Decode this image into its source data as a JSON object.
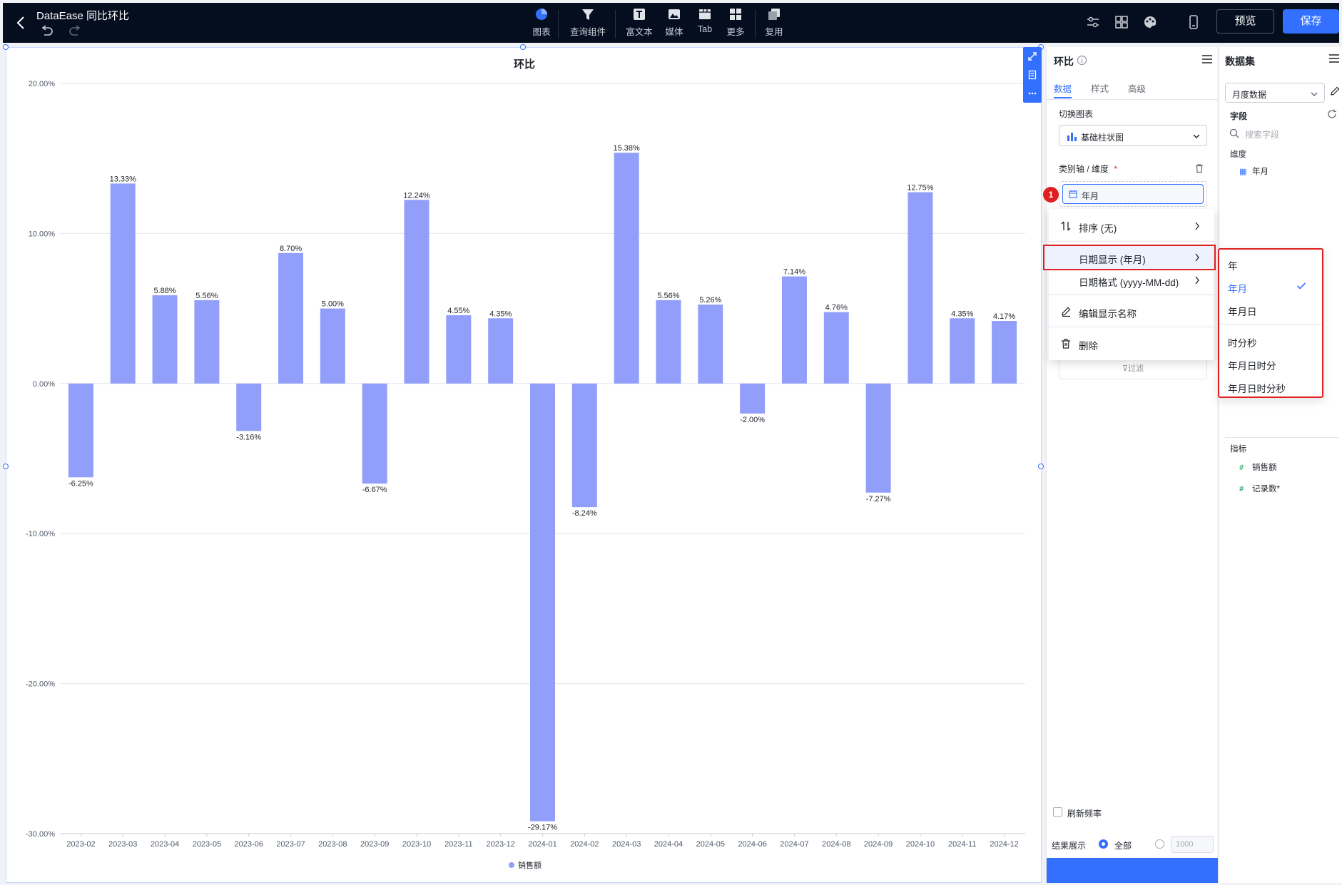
{
  "app": {
    "title": "DataEase 同比环比"
  },
  "toolbar": {
    "chart": "图表",
    "query": "查询组件",
    "richtext": "富文本",
    "media": "媒体",
    "tab": "Tab",
    "more": "更多",
    "reuse": "复用",
    "preview": "预览",
    "save": "保存"
  },
  "config": {
    "title": "环比",
    "tabs": [
      "数据",
      "样式",
      "高级"
    ],
    "switch_chart_label": "切换图表",
    "chart_type": "基础柱状图",
    "axis_label": "类别轴 / 维度",
    "required_mark": "*",
    "dimension_field": "年月",
    "badge": "1",
    "filter_text": "过滤",
    "refresh_label": "刷新频率",
    "result_label": "结果展示",
    "result_all": "全部",
    "result_limit": "1000"
  },
  "context_menu": {
    "sort": "排序 (无)",
    "date_display": "日期显示 (年月)",
    "date_format": "日期格式 (yyyy-MM-dd)",
    "edit_name": "编辑显示名称",
    "delete": "删除"
  },
  "date_submenu": {
    "items": [
      "年",
      "年月",
      "年月日",
      "时分秒",
      "年月日时分",
      "年月日时分秒"
    ],
    "selected": "年月"
  },
  "dataset": {
    "title": "数据集",
    "selected": "月度数据",
    "fields_label": "字段",
    "search_placeholder": "搜索字段",
    "dimension_label": "维度",
    "dimensions": [
      "年月"
    ],
    "metric_label": "指标",
    "metrics": [
      "销售额",
      "记录数*"
    ]
  },
  "colors": {
    "bar": "#929ffa",
    "accent": "#3370ff",
    "topbar": "#050e1f",
    "highlight": "#e02020"
  },
  "chart_data": {
    "type": "bar",
    "title": "环比",
    "categories": [
      "2023-02",
      "2023-03",
      "2023-04",
      "2023-05",
      "2023-06",
      "2023-07",
      "2023-08",
      "2023-09",
      "2023-10",
      "2023-11",
      "2023-12",
      "2024-01",
      "2024-02",
      "2024-03",
      "2024-04",
      "2024-05",
      "2024-06",
      "2024-07",
      "2024-08",
      "2024-09",
      "2024-10",
      "2024-11",
      "2024-12"
    ],
    "series": [
      {
        "name": "销售额",
        "values": [
          -6.25,
          13.33,
          5.88,
          5.56,
          -3.16,
          8.7,
          5.0,
          -6.67,
          12.24,
          4.55,
          4.35,
          -29.17,
          -8.24,
          15.38,
          5.56,
          5.26,
          -2.0,
          7.14,
          4.76,
          -7.27,
          12.75,
          4.35,
          4.17
        ],
        "labels": [
          "-6.25%",
          "13.33%",
          "5.88%",
          "5.56%",
          "-3.16%",
          "8.70%",
          "5.00%",
          "-6.67%",
          "12.24%",
          "4.55%",
          "4.35%",
          "-29.17%",
          "-8.24%",
          "15.38%",
          "5.56%",
          "5.26%",
          "-2.00%",
          "7.14%",
          "4.76%",
          "-7.27%",
          "12.75%",
          "4.35%",
          "4.17%"
        ]
      }
    ],
    "yticks": [
      "20.00%",
      "10.00%",
      "0.00%",
      "-10.00%",
      "-20.00%",
      "-30.00%"
    ],
    "ylim": [
      -30,
      20
    ],
    "grid": true,
    "legend": "bottom-center"
  }
}
